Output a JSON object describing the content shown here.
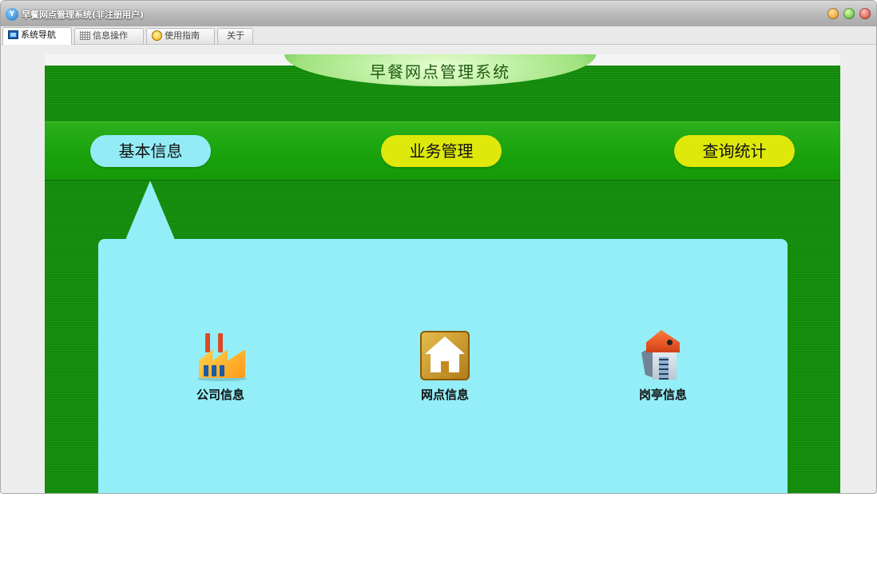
{
  "window": {
    "title": "早餐网点管理系统(非注册用户)"
  },
  "tabs": [
    {
      "label": "系统导航",
      "icon": "monitor-icon",
      "active": true
    },
    {
      "label": "信息操作",
      "icon": "grid-icon",
      "active": false
    },
    {
      "label": "使用指南",
      "icon": "guide-icon",
      "active": false
    },
    {
      "label": "关于",
      "icon": "",
      "active": false
    }
  ],
  "panel": {
    "title": "早餐网点管理系统"
  },
  "menu": [
    {
      "label": "基本信息",
      "selected": true
    },
    {
      "label": "业务管理",
      "selected": false
    },
    {
      "label": "查询统计",
      "selected": false
    }
  ],
  "items": [
    {
      "label": "公司信息",
      "icon": "factory-icon"
    },
    {
      "label": "网点信息",
      "icon": "house-icon"
    },
    {
      "label": "岗亭信息",
      "icon": "kiosk-icon"
    }
  ],
  "colors": {
    "panel_green": "#128a0a",
    "menubar_green": "#1aa40d",
    "selected_menu": "#93ecf5",
    "normal_menu": "#dee80b",
    "card": "#93eef7"
  }
}
